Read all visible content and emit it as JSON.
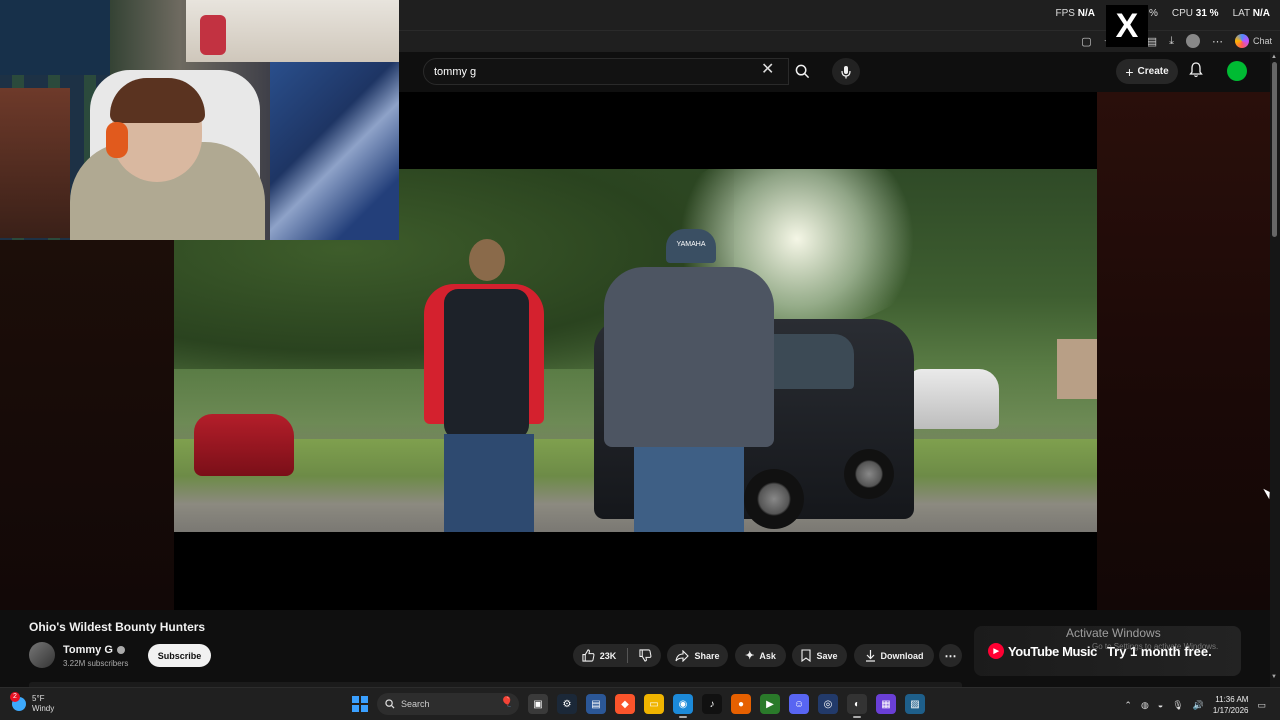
{
  "overlay": {
    "fps_label": "FPS",
    "fps_value": "N/A",
    "cpu_label": "CPU",
    "cpu_value": "31 %",
    "lat_label": "LAT",
    "lat_value": "N/A",
    "gpu_partial": "%",
    "x_logo": "X"
  },
  "browser": {
    "chat_label": "Chat"
  },
  "search": {
    "query": "tommy g"
  },
  "header": {
    "create_label": "Create"
  },
  "video": {
    "cap_text": "YAMAHA"
  },
  "info": {
    "title": "Ohio's Wildest Bounty Hunters",
    "channel_name": "Tommy G",
    "subscribers": "3.22M subscribers",
    "subscribe_label": "Subscribe",
    "likes": "23K",
    "share_label": "Share",
    "ask_label": "Ask",
    "save_label": "Save",
    "download_label": "Download"
  },
  "ad": {
    "brand": "YouTube Music",
    "cta": "Try 1 month free."
  },
  "watermark": {
    "title": "Activate Windows",
    "subtitle": "Go to Settings to activate Windows."
  },
  "taskbar": {
    "weather_temp": "5°F",
    "weather_desc": "Windy",
    "weather_badge": "2",
    "search_placeholder": "Search",
    "time": "11:36 AM",
    "date": "1/17/2026"
  },
  "colors": {
    "background": "#0f0f0f",
    "youtube_red": "#ff0033",
    "chip": "#272727"
  }
}
